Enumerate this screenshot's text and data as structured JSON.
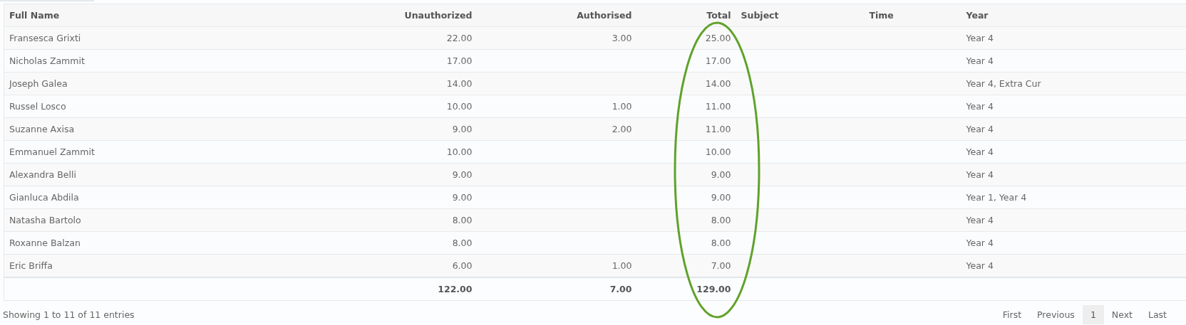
{
  "table": {
    "columns": [
      "Full Name",
      "Unauthorized",
      "Authorised",
      "Total",
      "Subject",
      "Time",
      "Year"
    ],
    "rows": [
      {
        "full_name": "Fransesca Grixti",
        "unauthorized": "22.00",
        "authorised": "3.00",
        "total": "25.00",
        "year": "Year 4"
      },
      {
        "full_name": "Nicholas Zammit",
        "unauthorized": "17.00",
        "total": "17.00",
        "year": "Year 4"
      },
      {
        "full_name": "Joseph Galea",
        "unauthorized": "14.00",
        "total": "14.00",
        "year": "Year 4, Extra Cur"
      },
      {
        "full_name": "Russel Losco",
        "unauthorized": "10.00",
        "authorised": "1.00",
        "total": "11.00",
        "year": "Year 4"
      },
      {
        "full_name": "Suzanne Axisa",
        "unauthorized": "9.00",
        "authorised": "2.00",
        "total": "11.00",
        "year": "Year 4"
      },
      {
        "full_name": "Emmanuel Zammit",
        "unauthorized": "10.00",
        "total": "10.00",
        "year": "Year 4"
      },
      {
        "full_name": "Alexandra Belli",
        "unauthorized": "9.00",
        "total": "9.00",
        "year": "Year 4"
      },
      {
        "full_name": "Gianluca Abdila",
        "unauthorized": "9.00",
        "total": "9.00",
        "year": "Year 1, Year 4"
      },
      {
        "full_name": "Natasha Bartolo",
        "unauthorized": "8.00",
        "total": "8.00",
        "year": "Year 4"
      },
      {
        "full_name": "Roxanne Balzan",
        "unauthorized": "8.00",
        "total": "8.00",
        "year": "Year 4"
      },
      {
        "full_name": "Eric Briffa",
        "unauthorized": "6.00",
        "authorised": "1.00",
        "total": "7.00",
        "year": "Year 4"
      }
    ],
    "totals": {
      "unauthorized": "122.00",
      "authorised": "7.00",
      "total": "129.00"
    }
  },
  "info": "Showing 1 to 11 of 11 entries",
  "pagination": [
    {
      "label": "First",
      "selected": false
    },
    {
      "label": "Previous",
      "selected": false
    },
    {
      "label": "1",
      "selected": true
    },
    {
      "label": "Next",
      "selected": false
    },
    {
      "label": "Last",
      "selected": false
    }
  ]
}
